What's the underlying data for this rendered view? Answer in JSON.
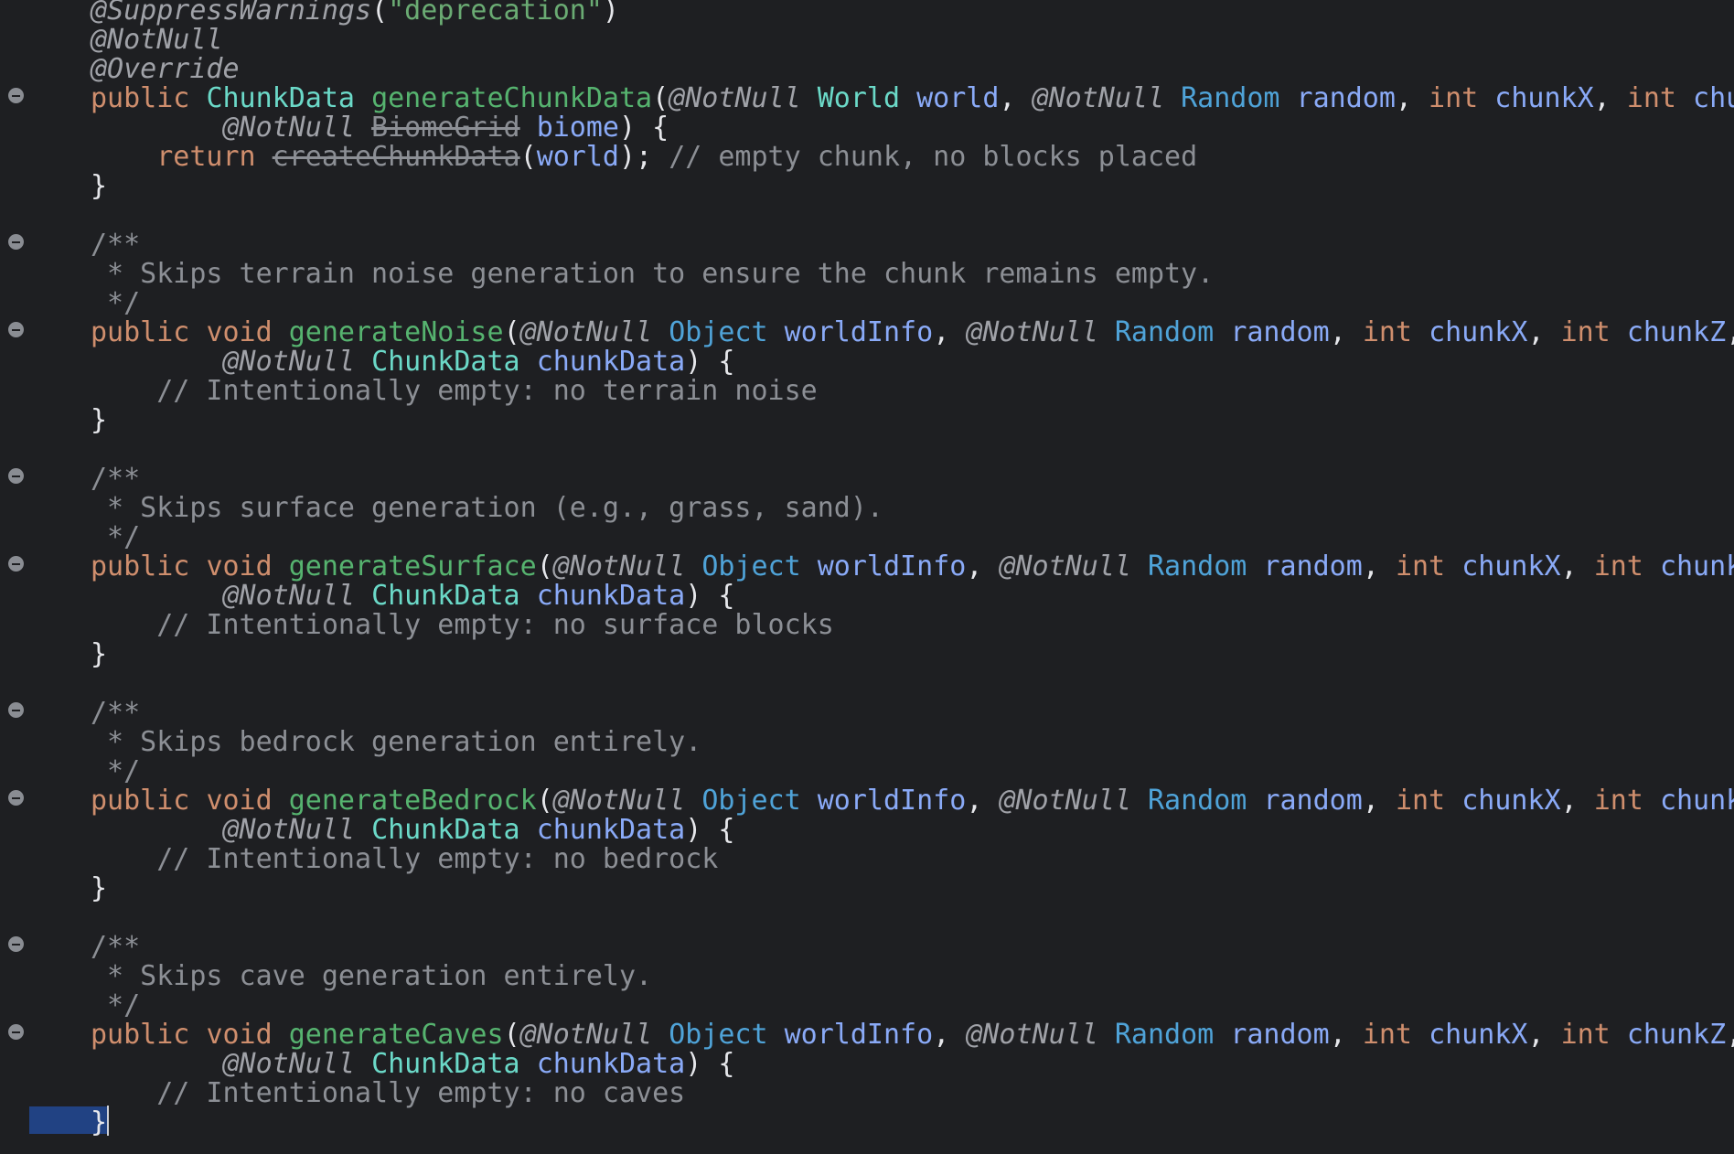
{
  "colors": {
    "background": "#1e1f22",
    "keyword": "#cf8e6d",
    "annotation": "#a0a2a8",
    "string": "#6aab73",
    "type": "#6bd9c8",
    "type_alt": "#4fa3d8",
    "method": "#56b36f",
    "parameter": "#8aaaf7",
    "comment": "#8c8f95",
    "selection": "#214283"
  },
  "code": {
    "suppress_annotation": "@SuppressWarnings",
    "suppress_value": "\"deprecation\"",
    "notnull": "@NotNull",
    "override": "@Override",
    "kw_public": "public",
    "kw_void": "void",
    "kw_int": "int",
    "kw_return": "return",
    "type_chunkdata": "ChunkData",
    "type_world": "World",
    "type_random": "Random",
    "type_object": "Object",
    "type_biomegrid": "BiomeGrid",
    "method_generate_chunk_data": "generateChunkData",
    "method_create_chunk_data": "createChunkData",
    "method_generate_noise": "generateNoise",
    "method_generate_surface": "generateSurface",
    "method_generate_bedrock": "generateBedrock",
    "method_generate_caves": "generateCaves",
    "param_world": "world",
    "param_random": "random",
    "param_chunkx": "chunkX",
    "param_chunkz": "chunkZ",
    "param_biome": "biome",
    "param_worldinfo": "worldInfo",
    "param_chunkdata": "chunkData",
    "comment_empty_chunk": "// empty chunk, no blocks placed",
    "doc_open": "/**",
    "doc_close": " */",
    "doc_noise": " * Skips terrain noise generation to ensure the chunk remains empty.",
    "doc_surface": " * Skips surface generation (e.g., grass, sand).",
    "doc_bedrock": " * Skips bedrock generation entirely.",
    "doc_caves": " * Skips cave generation entirely.",
    "comment_noise": "// Intentionally empty: no terrain noise",
    "comment_surface": "// Intentionally empty: no surface blocks",
    "comment_bedrock": "// Intentionally empty: no bedrock",
    "comment_caves": "// Intentionally empty: no caves",
    "close_brace": "}"
  }
}
